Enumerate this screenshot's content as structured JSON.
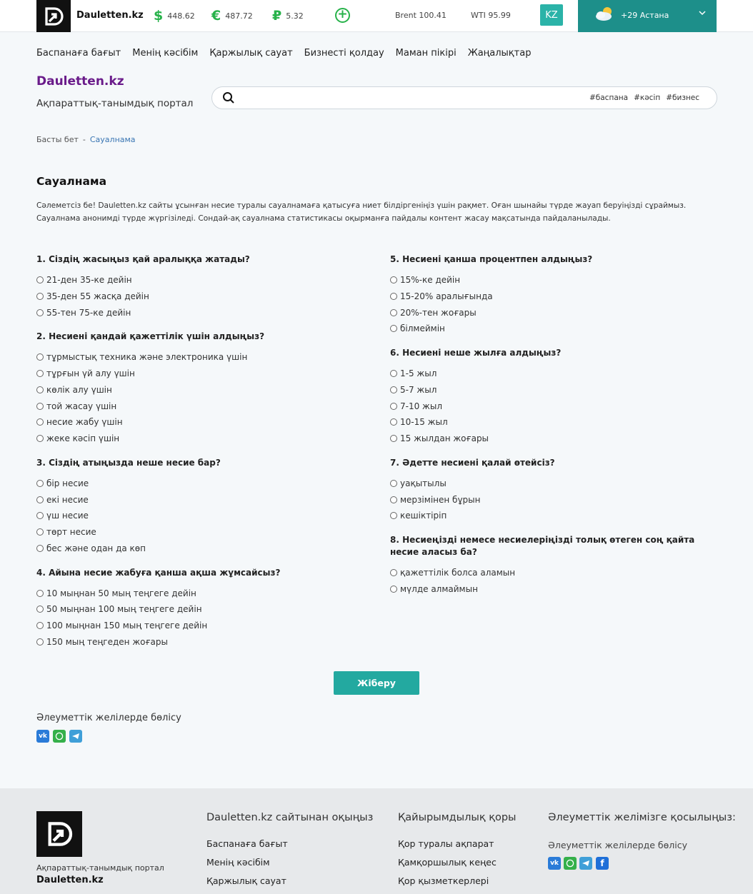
{
  "header": {
    "site_name": "Dauletten.kz",
    "rates": [
      {
        "symbol": "$",
        "value": "448.62"
      },
      {
        "symbol": "€",
        "value": "487.72"
      },
      {
        "symbol": "₽",
        "value": "5.32"
      }
    ],
    "oil": [
      {
        "label": "Brent 100.41"
      },
      {
        "label": "WTI 95.99"
      }
    ],
    "lang": "KZ",
    "weather": {
      "text": "+29  Астана"
    }
  },
  "nav": [
    "Баспанаға бағыт",
    "Менің кәсібім",
    "Қаржылық сауат",
    "Бизнесті қолдау",
    "Маман пікірі",
    "Жаңалықтар"
  ],
  "brand": {
    "title": "Dauletten.kz",
    "subtitle": "Ақпараттық-танымдық портал"
  },
  "search": {
    "value": "",
    "tags": [
      "#баспана",
      "#кәсіп",
      "#бизнес"
    ]
  },
  "breadcrumb": {
    "home": "Басты бет",
    "sep": "-",
    "current": "Сауалнама"
  },
  "page": {
    "title": "Сауалнама",
    "intro": "Сәлеметсіз бе! Dauletten.kz сайты ұсынған несие туралы сауалнамаға қатысуға ниет білдіргеніңіз үшін рақмет. Оған шынайы түрде жауап беруіңізді сұраймыз. Сауалнама анонимді түрде жүргізіледі. Сондай-ақ сауалнама статистикасы оқырманға пайдалы контент жасау мақсатында пайдаланылады."
  },
  "questions": [
    {
      "title": "1. Сіздің жасыңыз қай аралыққа жатады?",
      "options": [
        "21-ден 35-ке дейін",
        "35-ден 55 жасқа дейін",
        "55-тен 75-ке дейін"
      ]
    },
    {
      "title": "2. Несиені қандай қажеттілік үшін алдыңыз?",
      "options": [
        "тұрмыстық техника және электроника үшін",
        "тұрғын үй алу үшін",
        "көлік алу үшін",
        "той жасау үшін",
        "несие жабу үшін",
        "жеке кәсіп үшін"
      ]
    },
    {
      "title": "3. Сіздің атыңызда неше несие бар?",
      "options": [
        "бір несие",
        "екі несие",
        "үш несие",
        "төрт несие",
        "бес және одан да көп"
      ]
    },
    {
      "title": "4. Айына несие жабуға қанша ақша жұмсайсыз?",
      "options": [
        "10 мыңнан 50 мың теңгеге дейін",
        "50 мыңнан 100 мың теңгеге дейін",
        "100 мыңнан 150 мың теңгеге дейін",
        "150 мың теңгеден жоғары"
      ]
    },
    {
      "title": "5. Несиені қанша процентпен алдыңыз?",
      "options": [
        "15%-ке дейін",
        "15-20% аралығында",
        "20%-тен жоғары",
        "білмеймін"
      ]
    },
    {
      "title": "6. Несиені неше жылға алдыңыз?",
      "options": [
        "1-5 жыл",
        "5-7 жыл",
        "7-10 жыл",
        "10-15 жыл",
        "15 жылдан жоғары"
      ]
    },
    {
      "title": "7. Әдетте несиені қалай өтейсіз?",
      "options": [
        "уақытылы",
        "мерзімінен бұрын",
        "кешіктіріп"
      ]
    },
    {
      "title": "8. Несиеңізді немесе несиелеріңізді толық өтеген соң қайта несие аласыз ба?",
      "options": [
        "қажеттілік болса аламын",
        "мүлде алмаймын"
      ]
    }
  ],
  "submit_label": "Жіберу",
  "share": {
    "label": "Әлеуметтік желілерде бөлісу"
  },
  "colors": {
    "accent": "#23a9a0",
    "weather_bg": "#1d8f8a",
    "brand_purple": "#6a1b8a",
    "currency_green": "#27b24a",
    "vk": "#2a7bd8",
    "whatsapp": "#35b04a",
    "telegram": "#3f9fd8",
    "facebook": "#1f6fd8"
  },
  "footer": {
    "subtitle": "Ақпараттық-танымдық портал",
    "name": "Dauletten.kz",
    "col1": {
      "title": "Dauletten.kz сайтынан оқыңыз",
      "links": [
        "Баспанаға бағыт",
        "Менің кәсібім",
        "Қаржылық сауат"
      ]
    },
    "col2": {
      "title": "Қайырымдылық қоры",
      "links": [
        "Қор туралы ақпарат",
        "Қамқоршылық кеңес",
        "Қор қызметкерлері"
      ]
    },
    "col3": {
      "title": "Әлеуметтік желімізге қосылыңыз:",
      "share": "Әлеуметтік желілерде бөлісу"
    }
  }
}
